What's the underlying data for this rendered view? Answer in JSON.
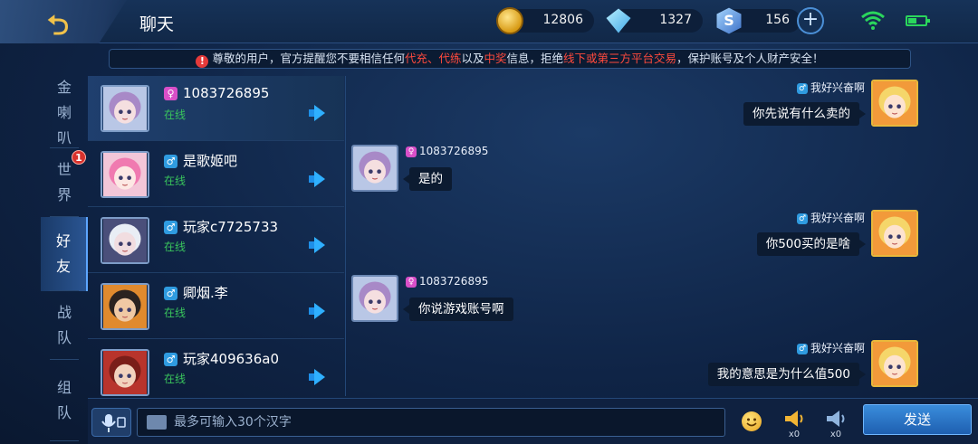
{
  "header": {
    "title": "聊天",
    "gold": "12806",
    "diamond": "1327",
    "coupon": "156"
  },
  "notice": {
    "parts": [
      {
        "text": "尊敬的用户，官方提醒您不要相信任何",
        "red": false
      },
      {
        "text": "代充、代练",
        "red": true
      },
      {
        "text": "以及",
        "red": false
      },
      {
        "text": "中奖",
        "red": true
      },
      {
        "text": "信息，拒绝",
        "red": false
      },
      {
        "text": "线下或第三方平台交易",
        "red": true
      },
      {
        "text": "，保护账号及个人财产安全！",
        "red": false
      }
    ]
  },
  "tabs": [
    {
      "label": "金喇叭",
      "chars": [
        "金",
        "喇",
        "叭"
      ],
      "active": false,
      "badge": ""
    },
    {
      "label": "世界",
      "chars": [
        "世",
        "界"
      ],
      "active": false,
      "badge": "1"
    },
    {
      "label": "好友",
      "chars": [
        "好",
        "友"
      ],
      "active": true,
      "badge": ""
    },
    {
      "label": "战队",
      "chars": [
        "战",
        "队"
      ],
      "active": false,
      "badge": ""
    },
    {
      "label": "组队",
      "chars": [
        "组",
        "队"
      ],
      "active": false,
      "badge": ""
    }
  ],
  "friends": [
    {
      "name": "1083726895",
      "gender": "female",
      "status": "在线"
    },
    {
      "name": "是歌姬吧",
      "gender": "male",
      "status": "在线"
    },
    {
      "name": "玩家c7725733",
      "gender": "male",
      "status": "在线"
    },
    {
      "name": "卿烟.李",
      "gender": "male",
      "status": "在线"
    },
    {
      "name": "玩家409636a0",
      "gender": "male",
      "status": "在线"
    }
  ],
  "messages": [
    {
      "side": "right",
      "name": "我好兴奋啊",
      "gender": "male",
      "text": "你先说有什么卖的"
    },
    {
      "side": "left",
      "name": "1083726895",
      "gender": "female",
      "text": "是的"
    },
    {
      "side": "right",
      "name": "我好兴奋啊",
      "gender": "male",
      "text": "你500买的是啥"
    },
    {
      "side": "left",
      "name": "1083726895",
      "gender": "female",
      "text": "你说游戏账号啊"
    },
    {
      "side": "right",
      "name": "我好兴奋啊",
      "gender": "male",
      "text": "我的意思是为什么值500"
    }
  ],
  "input": {
    "placeholder": "最多可输入30个汉字",
    "gold_horn_count": "x0",
    "blue_horn_count": "x0",
    "send_label": "发送"
  },
  "colors": {
    "accent": "#2fb0ff",
    "online": "#39c45c",
    "warning": "#ff4a3d"
  }
}
